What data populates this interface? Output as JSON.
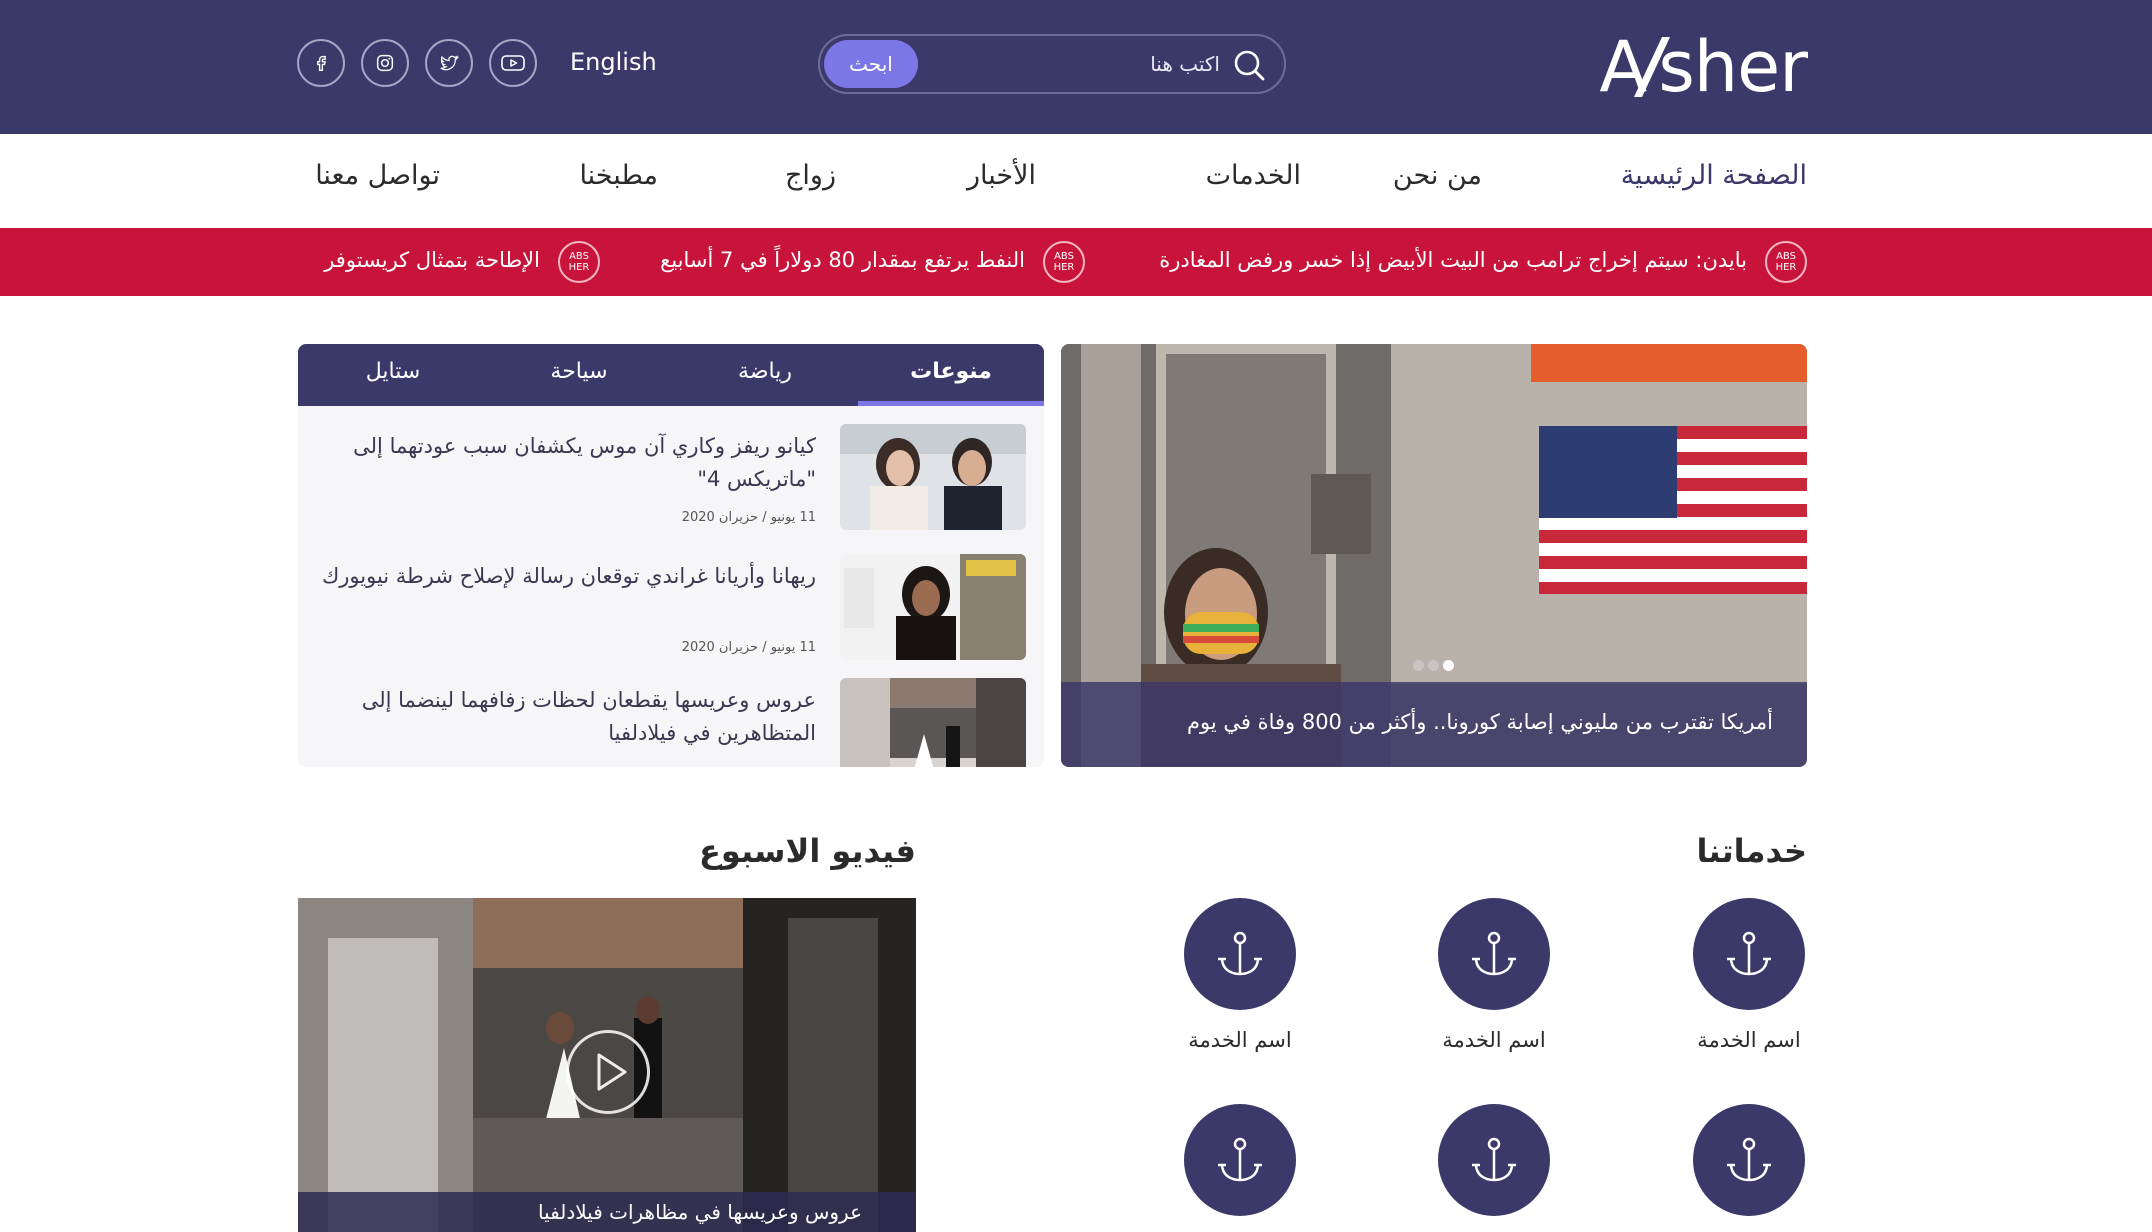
{
  "brand": {
    "logo_left": "A",
    "logo_right": "sher"
  },
  "header": {
    "search_button": "ابحث",
    "search_placeholder": "اكتب هنا",
    "language": "English",
    "social": [
      "facebook-icon",
      "instagram-icon",
      "twitter-icon",
      "youtube-icon"
    ]
  },
  "nav": {
    "items": [
      "الصفحة الرئيسية",
      "من نحن",
      "الخدمات",
      "الأخبار",
      "زواج",
      "مطبخنا",
      "تواصل معنا"
    ],
    "active_index": 0
  },
  "ticker": {
    "badge": "ABS HER",
    "items": [
      "بايدن: سيتم إخراج ترامب من البيت الأبيض إذا خسر ورفض المغادرة",
      "النفط يرتفع بمقدار 80 دولاراً في 7 أسابيع",
      "الإطاحة بتمثال كريستوفر"
    ]
  },
  "slider": {
    "caption": "أمريكا تقترب من مليوني إصابة كورونا.. وأكثر من 800 وفاة في يوم",
    "slides_count": 3,
    "active_slide": 1
  },
  "tabs": {
    "items": [
      "منوعات",
      "رياضة",
      "سياحة",
      "ستايل"
    ],
    "active_index": 0
  },
  "articles": [
    {
      "title": "كيانو ريفز وكاري آن موس يكشفان سبب عودتهما إلى \"ماتريكس 4\"",
      "date": "11 يونيو / حزيران 2020"
    },
    {
      "title": "ريهانا وأريانا غراندي توقعان رسالة لإصلاح شرطة نيويورك",
      "date": "11 يونيو / حزيران 2020"
    },
    {
      "title": "عروس وعريسها يقطعان لحظات زفافهما لينضما إلى المتظاهرين في فيلادلفيا",
      "date": ""
    }
  ],
  "services": {
    "title": "خدماتنا",
    "item_label": "اسم الخدمة",
    "icon": "anchor-icon"
  },
  "video": {
    "title": "فيديو الاسبوع",
    "caption": "عروس وعريسها في مظاهرات فيلادلفيا"
  },
  "colors": {
    "primary": "#3b386a",
    "accent": "#7b77e6",
    "ticker": "#c8143b"
  }
}
